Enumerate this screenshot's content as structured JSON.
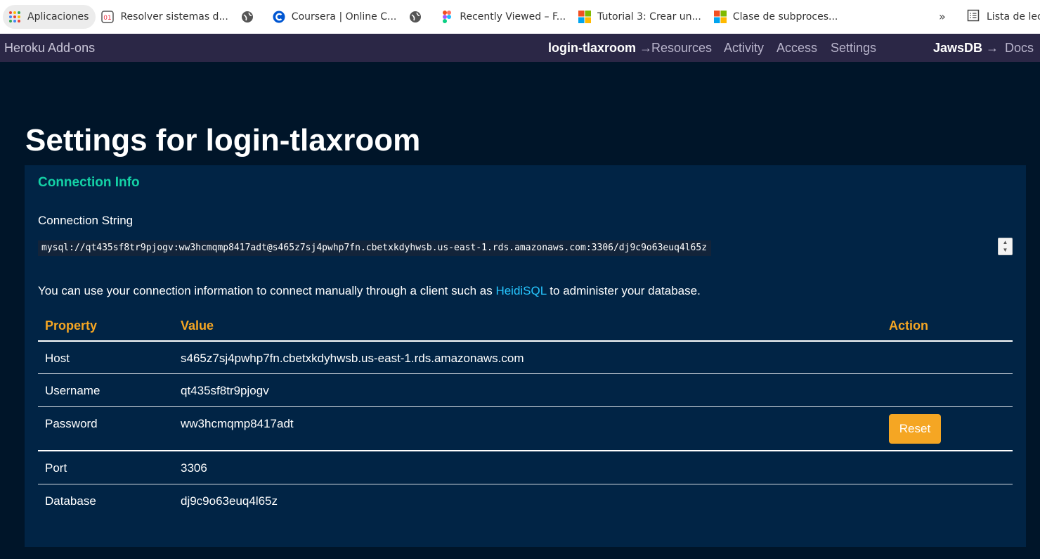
{
  "bookmarks": [
    {
      "label": "Aplicaciones",
      "icon": "apps-grid-icon"
    },
    {
      "label": "Resolver sistemas d...",
      "icon": "matrix-icon"
    },
    {
      "label": "",
      "icon": "globe-icon"
    },
    {
      "label": "Coursera | Online C...",
      "icon": "coursera-icon"
    },
    {
      "label": "",
      "icon": "globe-icon"
    },
    {
      "label": "Recently Viewed – F...",
      "icon": "figma-icon"
    },
    {
      "label": "Tutorial 3: Crear un...",
      "icon": "microsoft-icon"
    },
    {
      "label": "Clase de subproces...",
      "icon": "microsoft-icon"
    }
  ],
  "bookmarks_overflow": "»",
  "reading_list": "Lista de lect",
  "nav": {
    "brand": "Heroku Add-ons",
    "app": "login-tlaxroom",
    "arrow": "→",
    "links": [
      "Resources",
      "Activity",
      "Access",
      "Settings"
    ],
    "addon": "JawsDB",
    "docs": "Docs"
  },
  "page": {
    "title": "Settings for login-tlaxroom",
    "section_title": "Connection Info",
    "connection_string_label": "Connection String",
    "connection_string": "mysql://qt435sf8tr9pjogv:ww3hcmqmp8417adt@s465z7sj4pwhp7fn.cbetxkdyhwsb.us-east-1.rds.amazonaws.com:3306/dj9c9o63euq4l65z",
    "desc_before": "You can use your connection information to connect manually through a client such as ",
    "desc_link": "HeidiSQL",
    "desc_after": " to administer your database."
  },
  "table": {
    "headers": [
      "Property",
      "Value",
      "Action"
    ],
    "rows": [
      {
        "property": "Host",
        "value": "s465z7sj4pwhp7fn.cbetxkdyhwsb.us-east-1.rds.amazonaws.com",
        "action": ""
      },
      {
        "property": "Username",
        "value": "qt435sf8tr9pjogv",
        "action": ""
      },
      {
        "property": "Password",
        "value": "ww3hcmqmp8417adt",
        "action": "Reset"
      },
      {
        "property": "Port",
        "value": "3306",
        "action": ""
      },
      {
        "property": "Database",
        "value": "dj9c9o63euq4l65z",
        "action": ""
      }
    ]
  },
  "colors": {
    "accent_green": "#14d2a6",
    "accent_orange": "#f5a623",
    "link": "#26c6ff",
    "nav_bg": "#2b2746",
    "page_bg": "#001529",
    "panel_bg": "#012445"
  }
}
